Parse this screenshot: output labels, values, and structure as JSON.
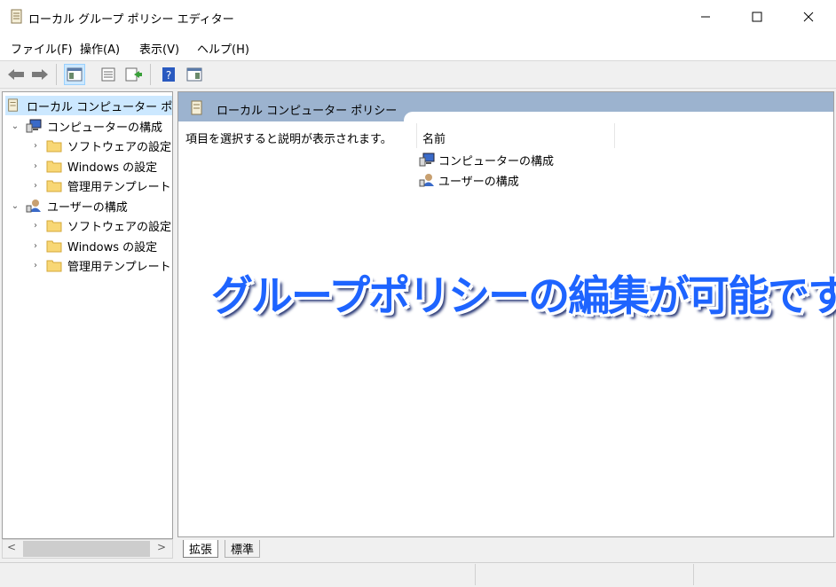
{
  "window": {
    "title": "ローカル グループ ポリシー エディター",
    "icon": "policy-scroll-icon",
    "controls": [
      "minimize-icon",
      "maximize-icon",
      "close-icon"
    ]
  },
  "menu": {
    "file": "ファイル(F)",
    "action": "操作(A)",
    "view": "表示(V)",
    "help": "ヘルプ(H)"
  },
  "toolbar": {
    "buttons": [
      "back-arrow-icon",
      "forward-arrow-icon",
      "show-hide-tree-icon",
      "properties-icon",
      "export-list-icon",
      "help-icon",
      "show-action-pane-icon"
    ]
  },
  "tree": {
    "root": "ローカル コンピューター ポリシー",
    "computer": {
      "label": "コンピューターの構成",
      "children": [
        "ソフトウェアの設定",
        "Windows の設定",
        "管理用テンプレート"
      ]
    },
    "user": {
      "label": "ユーザーの構成",
      "children": [
        "ソフトウェアの設定",
        "Windows の設定",
        "管理用テンプレート"
      ]
    }
  },
  "scrollbar": {
    "left": "<",
    "right": ">"
  },
  "content": {
    "banner_title": "ローカル コンピューター ポリシー",
    "description": "項目を選択すると説明が表示されます。",
    "column_name": "名前",
    "items": [
      "コンピューターの構成",
      "ユーザーの構成"
    ]
  },
  "overlay_caption": "グループポリシーの編集が可能です",
  "tabs": {
    "extended": "拡張",
    "standard": "標準"
  },
  "colors": {
    "banner": "#9cb3cf",
    "selection": "#cce8ff",
    "caption": "#1e64ff"
  }
}
